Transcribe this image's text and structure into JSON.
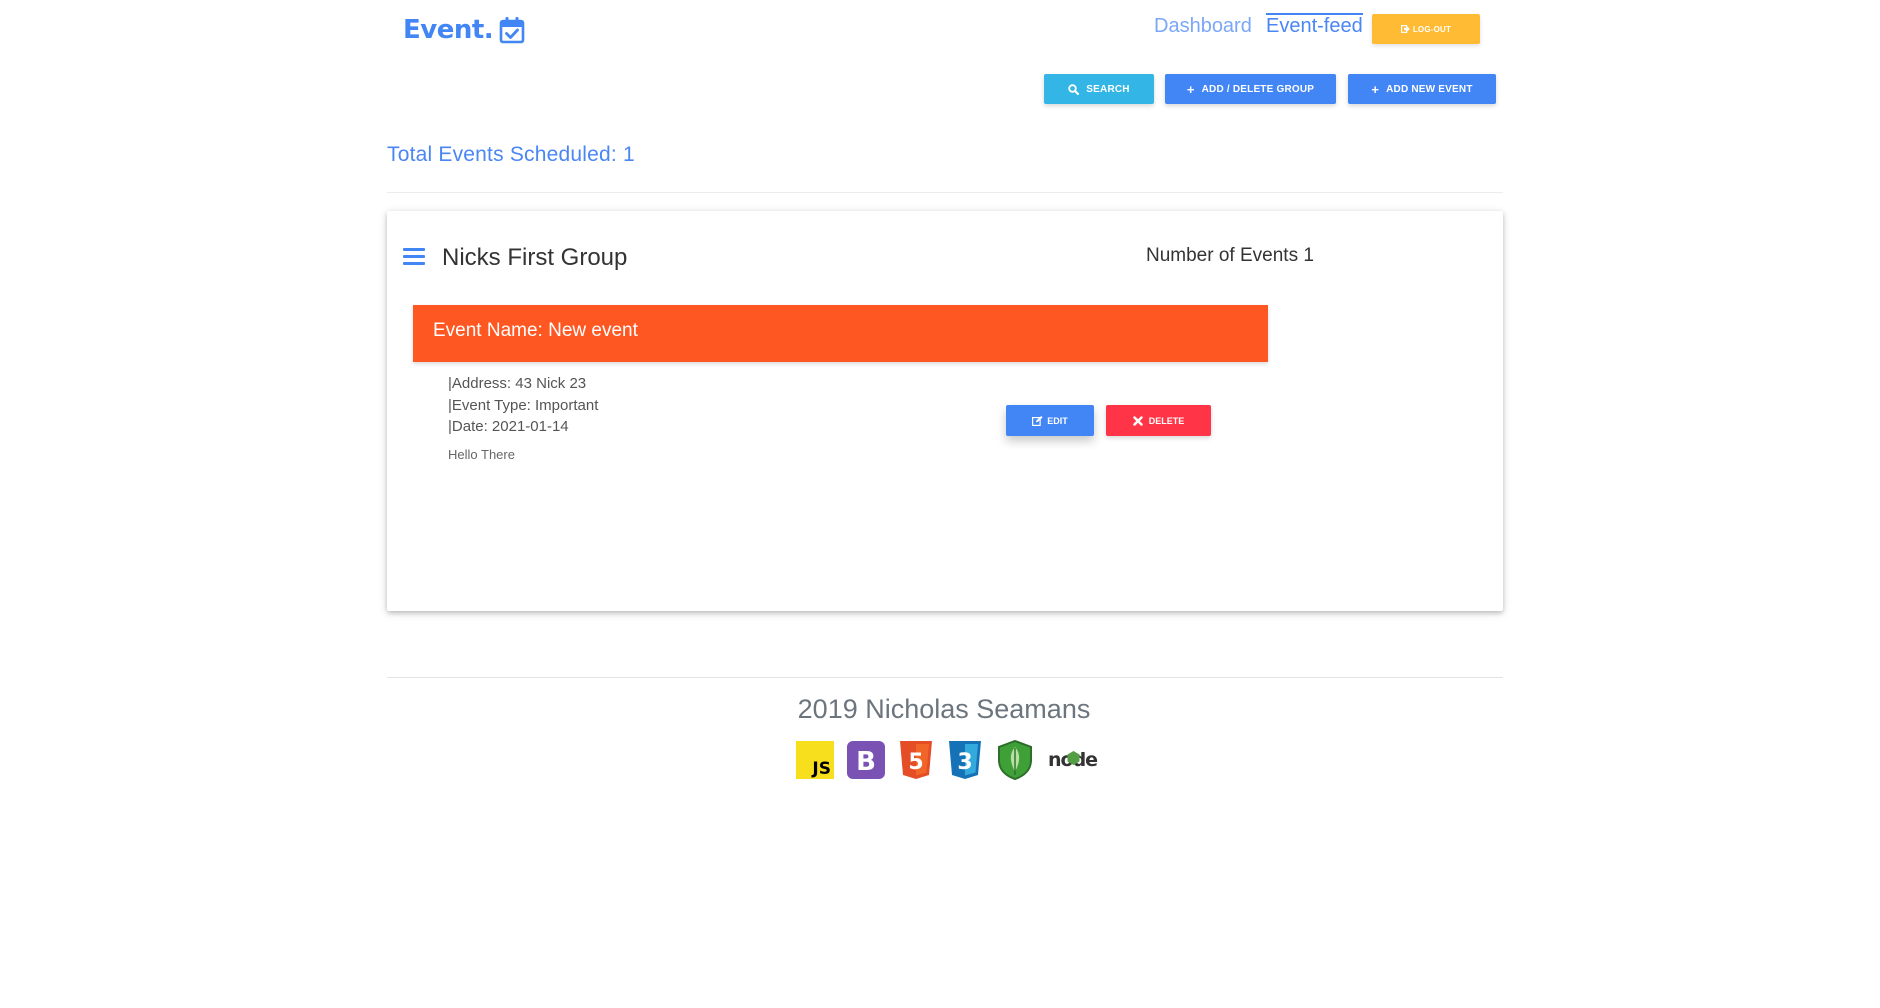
{
  "header": {
    "logo_text": "Event.",
    "logo_icon": "calendar-check-icon",
    "nav": {
      "dashboard": "Dashboard",
      "event_feed": "Event-feed"
    },
    "logout_label": "LOG-OUT"
  },
  "toolbar": {
    "search_label": "SEARCH",
    "group_label": "ADD / DELETE GROUP",
    "add_event_label": "ADD NEW EVENT"
  },
  "summary": {
    "total_events": "Total Events Scheduled: 1"
  },
  "group": {
    "name": "Nicks First Group",
    "event_count": "Number of Events 1",
    "events": [
      {
        "name": "Event Name: New event",
        "address": "|Address: 43 Nick 23",
        "type": "|Event Type: Important",
        "date": "|Date: 2021-01-14",
        "note": "Hello There",
        "edit_label": "EDIT",
        "delete_label": "DELETE"
      }
    ]
  },
  "footer": {
    "credit": "2019 Nicholas Seamans",
    "tech_icons": [
      "javascript-icon",
      "bootstrap-icon",
      "html5-icon",
      "css3-icon",
      "mongodb-icon",
      "nodejs-icon"
    ],
    "node_logo_text": "node"
  },
  "colors": {
    "primary": "#4285f4",
    "info": "#33b5e5",
    "warning": "#ffbb33",
    "event_header": "#ff5722",
    "danger": "#ff3547"
  }
}
